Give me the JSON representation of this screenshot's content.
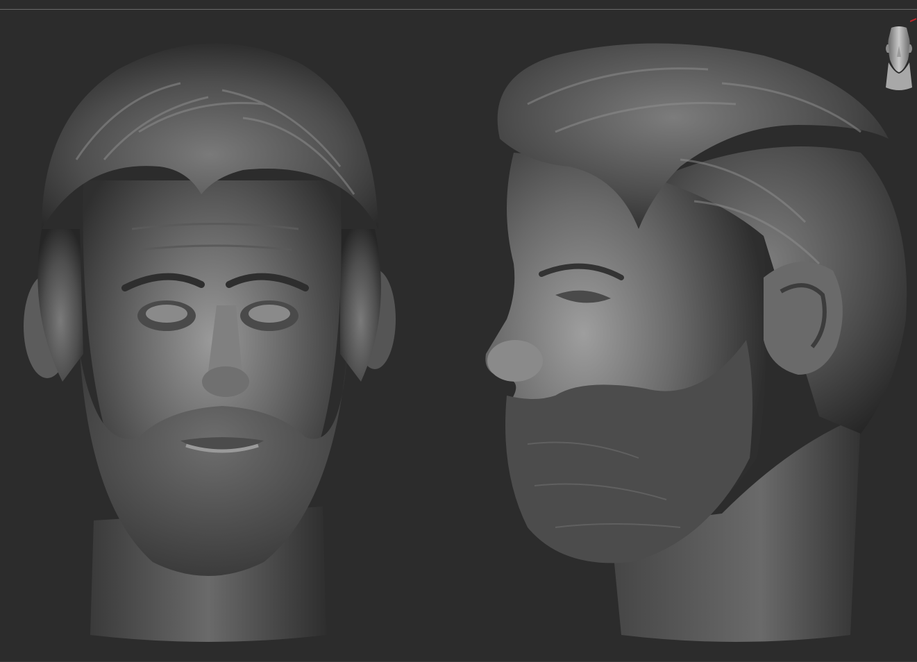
{
  "app": {
    "background_color": "#2c2c2c",
    "border_color": "#6a6a6a",
    "axis_accent_color": "#c0262b"
  },
  "viewport": {
    "views": [
      {
        "id": "front",
        "icon": "head-sculpt-front-view"
      },
      {
        "id": "side",
        "icon": "head-sculpt-profile-view"
      }
    ],
    "navigator": {
      "icon": "navigation-head-icon"
    }
  }
}
